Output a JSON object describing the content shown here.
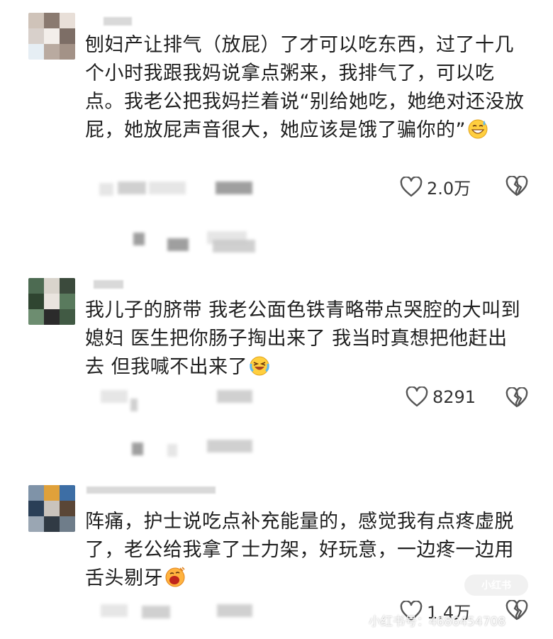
{
  "comments": [
    {
      "text": "刨妇产让排气（放屁）了才可以吃东西，过了十几个小时我跟我妈说拿点粥来，我排气了，可以吃点。我老公把我妈拦着说“别给她吃，她绝对还没放屁，她放屁声音很大，她应该是饿了骗你的”",
      "emoji": "sweat-grin-emoji",
      "likes": "2.0万"
    },
    {
      "text": "我儿子的脐带 我老公面色铁青略带点哭腔的大叫到 媳妇 医生把你肠子掏出来了 我当时真想把他赶出去 但我喊不出来了",
      "emoji": "crying-laughing-emoji",
      "likes": "8291"
    },
    {
      "text": "阵痛，护士说吃点补充能量的，感觉我有点疼虚脱了，老公给我拿了士力架，好玩意，一边疼一边用舌头剔牙",
      "emoji": "yawning-emoji",
      "likes": "1.4万"
    }
  ],
  "icons": {
    "like": "heart-outline-icon",
    "dislike": "broken-heart-icon"
  },
  "watermark": {
    "text": "小红书号：4686454708",
    "logo": "小红书"
  },
  "colors": {
    "text": "#1f1f1f",
    "icon": "#555555",
    "background": "#ffffff"
  }
}
